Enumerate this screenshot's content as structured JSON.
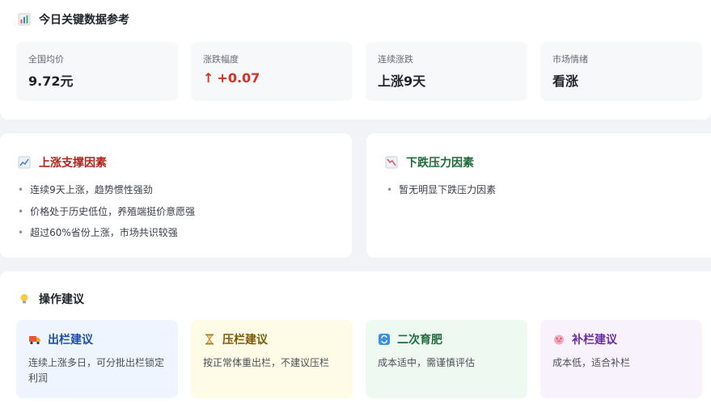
{
  "key_data": {
    "title": "今日关键数据参考",
    "icon": "bar-chart-icon",
    "stats": [
      {
        "label": "全国均价",
        "value": "9.72元"
      },
      {
        "label": "涨跌幅度",
        "value": "+0.07",
        "arrow": "↑",
        "color": "#d93026"
      },
      {
        "label": "连续涨跌",
        "value": "上涨9天"
      },
      {
        "label": "市场情绪",
        "value": "看涨"
      }
    ]
  },
  "rise_factors": {
    "title": "上涨支撑因素",
    "icon": "trend-up-icon",
    "color": "#b42318",
    "items": [
      "连续9天上涨，趋势惯性强劲",
      "价格处于历史低位，养殖端挺价意愿强",
      "超过60%省份上涨，市场共识较强"
    ]
  },
  "fall_factors": {
    "title": "下跌压力因素",
    "icon": "trend-down-icon",
    "color": "#1e6b3a",
    "items": [
      "暂无明显下跌压力因素"
    ]
  },
  "operations": {
    "title": "操作建议",
    "icon": "lightbulb-icon",
    "cards": [
      {
        "title": "出栏建议",
        "icon": "truck-icon",
        "desc": "连续上涨多日，可分批出栏锁定利润"
      },
      {
        "title": "压栏建议",
        "icon": "hourglass-icon",
        "desc": "按正常体重出栏，不建议压栏"
      },
      {
        "title": "二次育肥",
        "icon": "refresh-icon",
        "desc": "成本适中，需谨慎评估"
      },
      {
        "title": "补栏建议",
        "icon": "pig-icon",
        "desc": "成本低，适合补栏"
      }
    ]
  }
}
